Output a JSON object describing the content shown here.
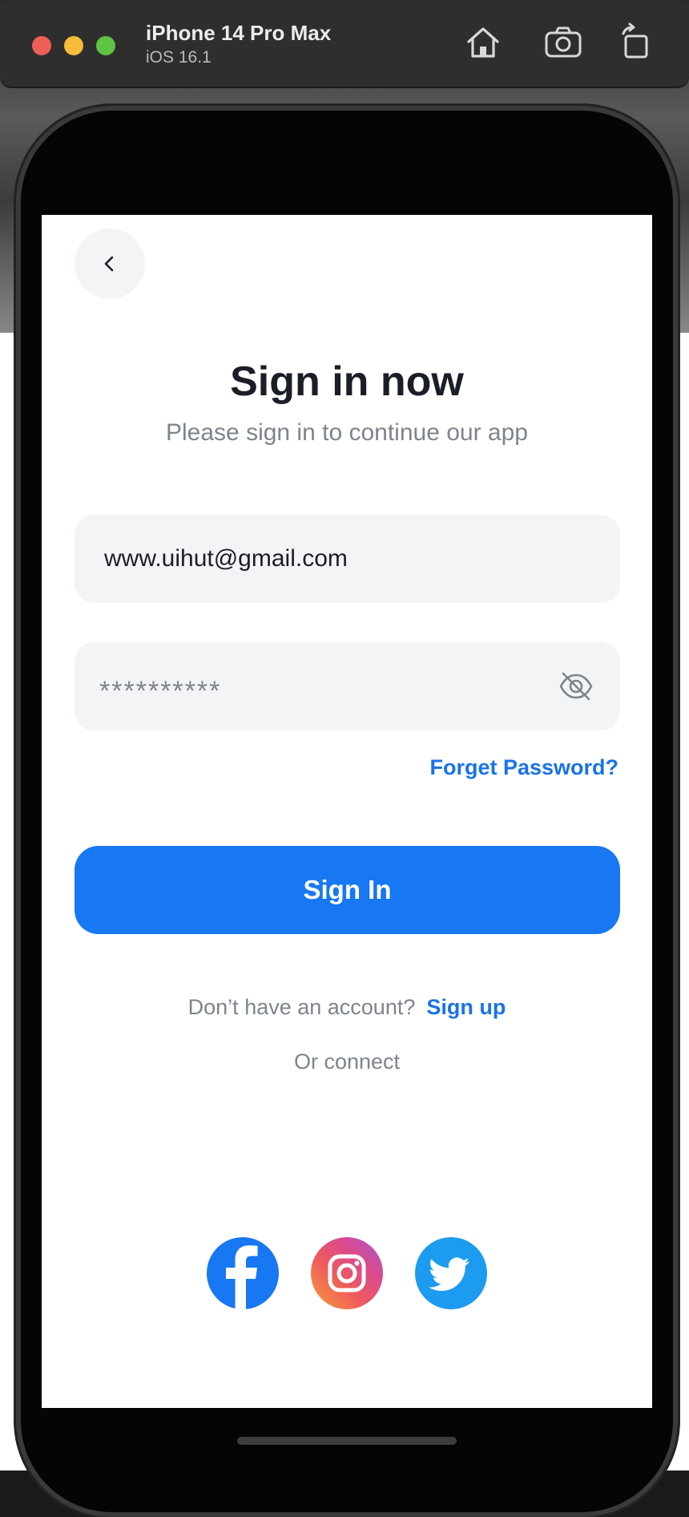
{
  "simulator": {
    "device_name": "iPhone 14 Pro Max",
    "os_version": "iOS 16.1",
    "buttons": [
      "home-icon",
      "screenshot-icon",
      "rotate-icon"
    ]
  },
  "screen": {
    "title": "Sign in now",
    "subtitle": "Please sign in to continue our app",
    "email": {
      "value": "www.uihut@gmail.com"
    },
    "password": {
      "value": "**********",
      "visibility_icon": "eye-off-icon"
    },
    "forgot_password": "Forget Password?",
    "signin_label": "Sign In",
    "signup_prompt": "Don’t have an account?",
    "signup_link": "Sign up",
    "or_connect": "Or connect",
    "social": [
      "facebook-icon",
      "instagram-icon",
      "twitter-icon"
    ]
  },
  "colors": {
    "primary": "#1877f2",
    "link": "#1a73e8",
    "field_bg": "#f3f4f6",
    "title_text": "#1b1e28",
    "muted_text": "#7d848d"
  }
}
